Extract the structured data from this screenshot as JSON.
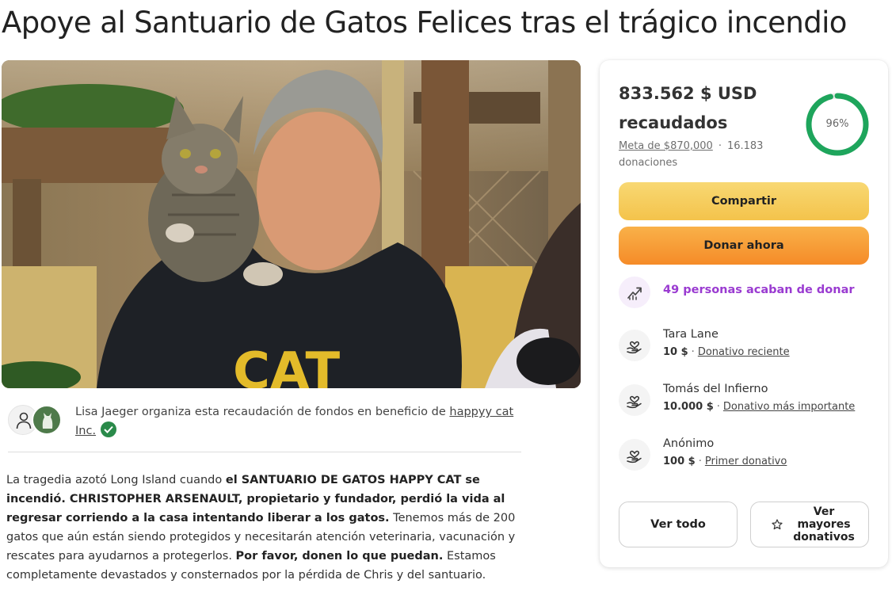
{
  "page": {
    "title": "Apoye al Santuario de Gatos Felices tras el trágico incendio"
  },
  "organizer": {
    "text": "Lisa Jaeger organiza esta recaudación de fondos en beneficio de ",
    "beneficiary_link": "happyy cat Inc.",
    "verified": true
  },
  "story": {
    "p1": "La tragedia azotó Long Island cuando ",
    "b1": "el SANTUARIO DE GATOS HAPPY CAT se incendió. CHRISTOPHER ARSENAULT, propietario y fundador, perdió la vida al regresar corriendo a la casa intentando liberar a los gatos.",
    "p2": " Tenemos más de 200 gatos que aún están siendo protegidos y necesitarán atención veterinaria, vacunación y rescates para ayudarnos a protegerlos. ",
    "b2": "Por favor, donen lo que puedan.",
    "p3": " Estamos completamente devastados y consternados por la pérdida de Chris y del santuario."
  },
  "donation_card": {
    "raised_amount": "833.562 $ USD",
    "raised_label": "recaudados",
    "goal": "Meta de $870,000",
    "separator": "·",
    "donations": "16.183 donaciones",
    "progress_label": "96%",
    "progress_fraction": 0.96,
    "share_label": "Compartir",
    "donate_label": "Donar ahora",
    "recent_label": "49 personas acaban de donar",
    "donors": [
      {
        "name": "Tara Lane",
        "amount": "10 $",
        "tag": "Donativo reciente"
      },
      {
        "name": "Tomás del Infierno",
        "amount": "10.000 $",
        "tag": "Donativo más importante"
      },
      {
        "name": "Anónimo",
        "amount": "100 $",
        "tag": "Primer donativo"
      }
    ],
    "see_all_label": "Ver todo",
    "top_donations_label": "Ver mayores donativos"
  },
  "colors": {
    "progress_green": "#1ea55c",
    "share_button": "#f4c34b",
    "donate_button": "#f58b28",
    "recent_purple": "#9a3bd1"
  }
}
